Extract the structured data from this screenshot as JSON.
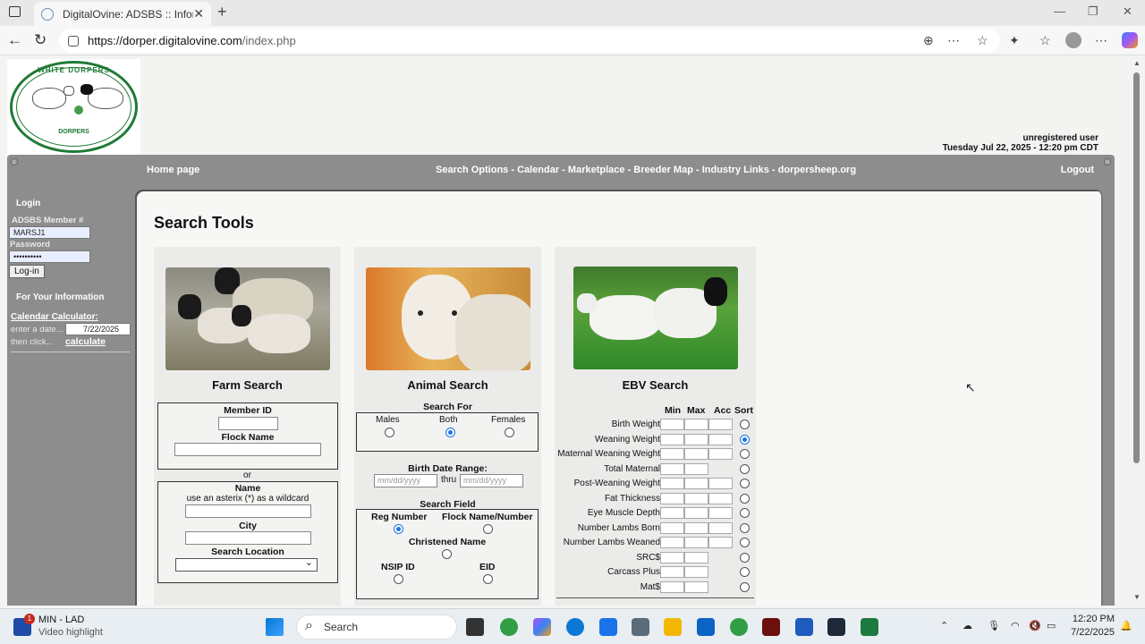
{
  "browser": {
    "tab_title": "DigitalOvine: ADSBS :: Information",
    "url_host": "https://dorper.digitalovine.com",
    "url_path": "/index.php"
  },
  "header": {
    "logo_top": "WHITE DORPERS",
    "logo_bottom": "DORPERS",
    "logo_ring": "AMERICAN DORPER SHEEP BREEDERS SOCIETY",
    "user_status": "unregistered user",
    "date_time": "Tuesday Jul 22, 2025 - 12:20 pm CDT"
  },
  "topnav": {
    "home": "Home page",
    "links": "Search Options - Calendar - Marketplace - Breeder Map - Industry Links - dorpersheep.org",
    "logout": "Logout"
  },
  "leftnav": {
    "login_heading": "Login",
    "member_label": "ADSBS Member #",
    "member_value": "MARSJ1",
    "password_label": "Password",
    "password_value": "••••••••••",
    "login_button": "Log-in",
    "info_heading": "For Your Information",
    "calc_heading": "Calendar Calculator:",
    "enter_date": "enter a date...",
    "date_value": "7/22/2025",
    "then_click": "then click...",
    "calculate": "calculate"
  },
  "main": {
    "title": "Search Tools",
    "farm": {
      "heading": "Farm Search",
      "member_id": "Member ID",
      "flock_name": "Flock Name",
      "or": "or",
      "name": "Name",
      "wildcard": "use an asterix (*) as a wildcard",
      "city": "City",
      "search_location": "Search Location"
    },
    "animal": {
      "heading": "Animal Search",
      "search_for": "Search For",
      "males": "Males",
      "both": "Both",
      "females": "Females",
      "birth_range": "Birth Date Range:",
      "date_placeholder": "mm/dd/yyyy",
      "thru": "thru",
      "search_field": "Search Field",
      "reg_number": "Reg Number",
      "flock_name_number": "Flock Name/Number",
      "christened": "Christened Name",
      "nsip": "NSIP ID",
      "eid": "EID"
    },
    "ebv": {
      "heading": "EBV Search",
      "cols": [
        "Min",
        "Max",
        "Acc",
        "Sort"
      ],
      "rows": [
        {
          "label": "Birth Weight",
          "acc": true,
          "on": false
        },
        {
          "label": "Weaning Weight",
          "acc": true,
          "on": true
        },
        {
          "label": "Maternal Weaning Weight",
          "acc": true,
          "on": false
        },
        {
          "label": "Total Maternal",
          "acc": false,
          "on": false
        },
        {
          "label": "Post-Weaning Weight",
          "acc": true,
          "on": false
        },
        {
          "label": "Fat Thickness",
          "acc": true,
          "on": false
        },
        {
          "label": "Eye Muscle Depth",
          "acc": true,
          "on": false
        },
        {
          "label": "Number Lambs Born",
          "acc": true,
          "on": false
        },
        {
          "label": "Number Lambs Weaned",
          "acc": true,
          "on": false
        },
        {
          "label": "SRC$",
          "acc": false,
          "on": false
        },
        {
          "label": "Carcass Plus",
          "acc": false,
          "on": false
        },
        {
          "label": "Mat$",
          "acc": false,
          "on": false
        }
      ]
    }
  },
  "taskbar": {
    "notif_badge": "1",
    "notif_title": "MIN - LAD",
    "notif_sub": "Video highlight",
    "search": "Search",
    "time": "12:20 PM",
    "date": "7/22/2025"
  }
}
